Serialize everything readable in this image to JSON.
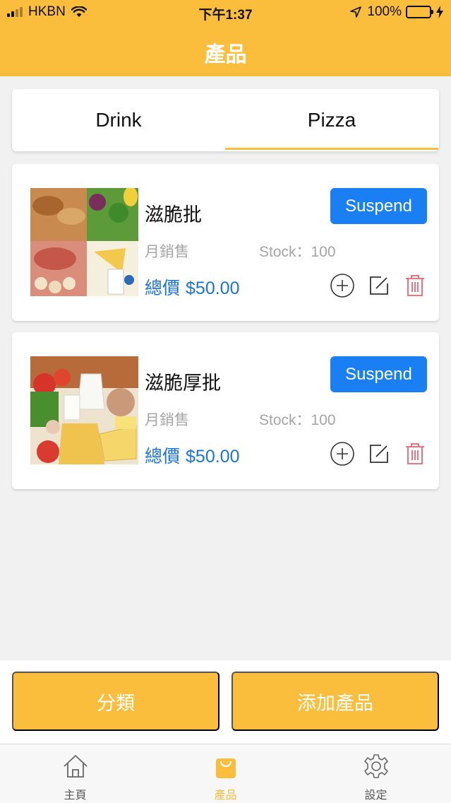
{
  "status_bar": {
    "carrier": "HKBN",
    "time": "下午1:37",
    "battery": "100%",
    "signal_icon": "cellular-signal-icon",
    "wifi_icon": "wifi-icon",
    "location_icon": "location-arrow-icon",
    "battery_icon": "battery-icon",
    "charging_icon": "charging-bolt-icon"
  },
  "header": {
    "title": "產品"
  },
  "category_tabs": [
    {
      "label": "Drink",
      "selected": false
    },
    {
      "label": "Pizza",
      "selected": true
    }
  ],
  "products": [
    {
      "name": "滋脆批",
      "monthly_sales_label": "月銷售",
      "stock_text": "Stock：100",
      "total_label": "總價",
      "price": "$50.00",
      "suspend_label": "Suspend",
      "image": "food-assortment-photo"
    },
    {
      "name": "滋脆厚批",
      "monthly_sales_label": "月銷售",
      "stock_text": "Stock：100",
      "total_label": "總價",
      "price": "$50.00",
      "suspend_label": "Suspend",
      "image": "dairy-and-vegetables-photo"
    }
  ],
  "row_actions": [
    "plus-circle-icon",
    "edit-icon",
    "trash-icon"
  ],
  "actions": {
    "category_label": "分類",
    "add_product_label": "添加產品"
  },
  "tab_bar": [
    {
      "label": "主頁",
      "icon": "home-icon",
      "active": false
    },
    {
      "label": "產品",
      "icon": "shopping-bag-icon",
      "active": true
    },
    {
      "label": "設定",
      "icon": "gear-icon",
      "active": false
    }
  ],
  "colors": {
    "accent": "#fbbd3c",
    "primary_blue": "#1a7ff3",
    "price_blue": "#1a73d9",
    "delete_red": "#f0616f",
    "battery_green": "#37c837"
  }
}
